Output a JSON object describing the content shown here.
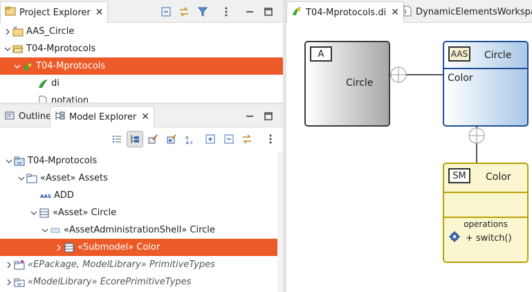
{
  "project_explorer": {
    "tab_label": "Project Explorer",
    "items": [
      {
        "label": "AAS_Circle"
      },
      {
        "label": "T04-Mprotocols"
      },
      {
        "label": "T04-Mprotocols"
      },
      {
        "label": "di"
      },
      {
        "label": "notation"
      }
    ]
  },
  "model_explorer": {
    "tabs": [
      {
        "label": "Outline"
      },
      {
        "label": "Model Explorer"
      }
    ],
    "items": [
      {
        "label": "T04-Mprotocols"
      },
      {
        "label": "«Asset» Assets"
      },
      {
        "label": "ADD"
      },
      {
        "label": "«Asset» Circle"
      },
      {
        "label": "«AssetAdministrationShell» Circle"
      },
      {
        "label": "«Submodel» Color"
      },
      {
        "stereo": "«EPackage, ModelLibrary»",
        "label": "PrimitiveTypes"
      },
      {
        "stereo": "«ModelLibrary»",
        "label": "EcorePrimitiveTypes"
      }
    ]
  },
  "editor": {
    "tabs": [
      {
        "label": "T04-Mprotocols.di"
      },
      {
        "label": "DynamicElementsWorkspace"
      }
    ]
  },
  "diagram": {
    "asset_node": {
      "stereo_tag": "A",
      "name": "Circle"
    },
    "aas_node": {
      "stereo_tag": "AAS",
      "name": "Circle",
      "property": "Color"
    },
    "sm_node": {
      "stereo_tag": "SM",
      "name": "Color",
      "operations_label": "operations",
      "operation": "+ switch()"
    }
  },
  "colors": {
    "selection": "#ec5a27",
    "aas_border": "#1f4e96",
    "sm_border": "#b8a000",
    "sm_fill": "#faf6d0"
  }
}
